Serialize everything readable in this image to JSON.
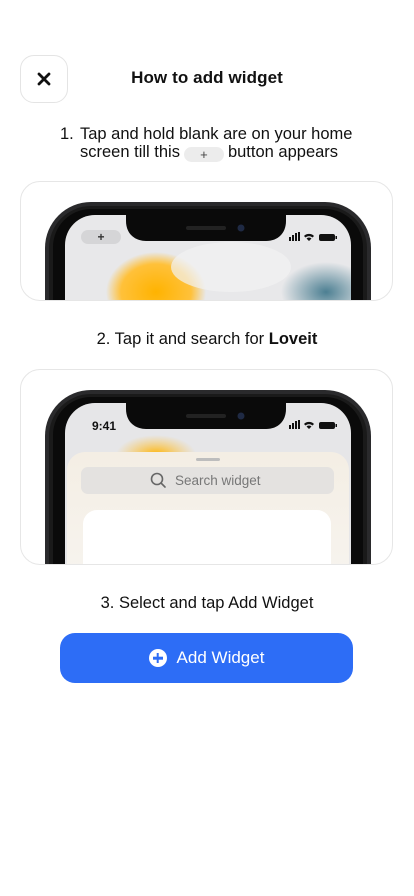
{
  "header": {
    "close_icon": "close-icon",
    "title": "How to add widget"
  },
  "steps": {
    "step1": {
      "number": "1.",
      "line1": "Tap and hold blank are on your home",
      "line2_before": "screen till this",
      "pill_glyph": "+",
      "line2_after": "button appears"
    },
    "step2": {
      "text": "2. Tap it and search for ",
      "bold": "Loveit"
    },
    "step3": {
      "text": "3. Select and tap Add Widget"
    }
  },
  "phone2": {
    "time": "9:41",
    "search_placeholder": "Search widget"
  },
  "add_button": {
    "label": "Add Widget",
    "color": "#2d6df6"
  }
}
